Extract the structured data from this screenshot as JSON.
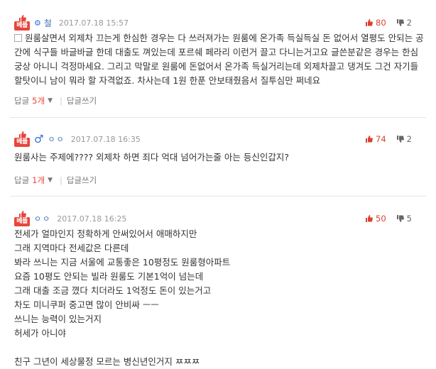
{
  "comments": [
    {
      "best_label": "베플",
      "nick": "철",
      "date": "2017.07.18 15:57",
      "up": "80",
      "down": "2",
      "body": "원룸살면서 외제차 끄는게 한심한 경우는 다 쓰러져가는 원룸에 온가족 득실득실 돈 없어서 열평도 안되는 공간에 식구들 바글바글 한데 대출도 껴있는데 포르쉐 페라리 이런거 끌고 다니는거고요 글쓴분같은 경우는 한심궁상 아니니 걱정마세요. 그리고 막말로 원룸에 돈없어서 온가족 득실거리는데 외제차끌고 댕겨도 그건 자기들 할탓이니 남이 뭐라 할 자격없죠. 차사는데 1원 한푼 안보태줬음서 질투심만 쩌네요",
      "reply_label": "답글",
      "reply_count": "5개",
      "write_reply": "답글쓰기"
    },
    {
      "best_label": "베플",
      "gender": "♂",
      "nick": "ㅇㅇ",
      "date": "2017.07.18 16:35",
      "up": "74",
      "down": "2",
      "body": "원룸사는 주제에???? 외제차 하면 죄다 억대 넘어가는줄 아는 등신인갑지?",
      "reply_label": "답글",
      "reply_count": "1개",
      "write_reply": "답글쓰기"
    },
    {
      "best_label": "베플",
      "nick": "ㅇㅇ",
      "date": "2017.07.18 16:25",
      "up": "50",
      "down": "5",
      "body": "전세가 얼마인지 정확하게 안써있어서 애매하지만\n그래 지역마다 전세값은 다른데\n봐라 쓰니는 지금 서울에 교통좋은 10평정도 원룸형아파트\n요즘 10평도 안되는 빌라 원룸도 기본1억이 넘는데\n그래 대출 조금 꼈다 치더라도 1억정도 돈이 있는거고\n차도 미니쿠퍼 중고면 많이 안비싸 ㅡㅡ\n쓰니는 능력이 있는거지\n허세가 아니야\n\n친구 그년이 세상물정 모르는 병신년인거지 ㅉㅉㅉ"
    }
  ]
}
